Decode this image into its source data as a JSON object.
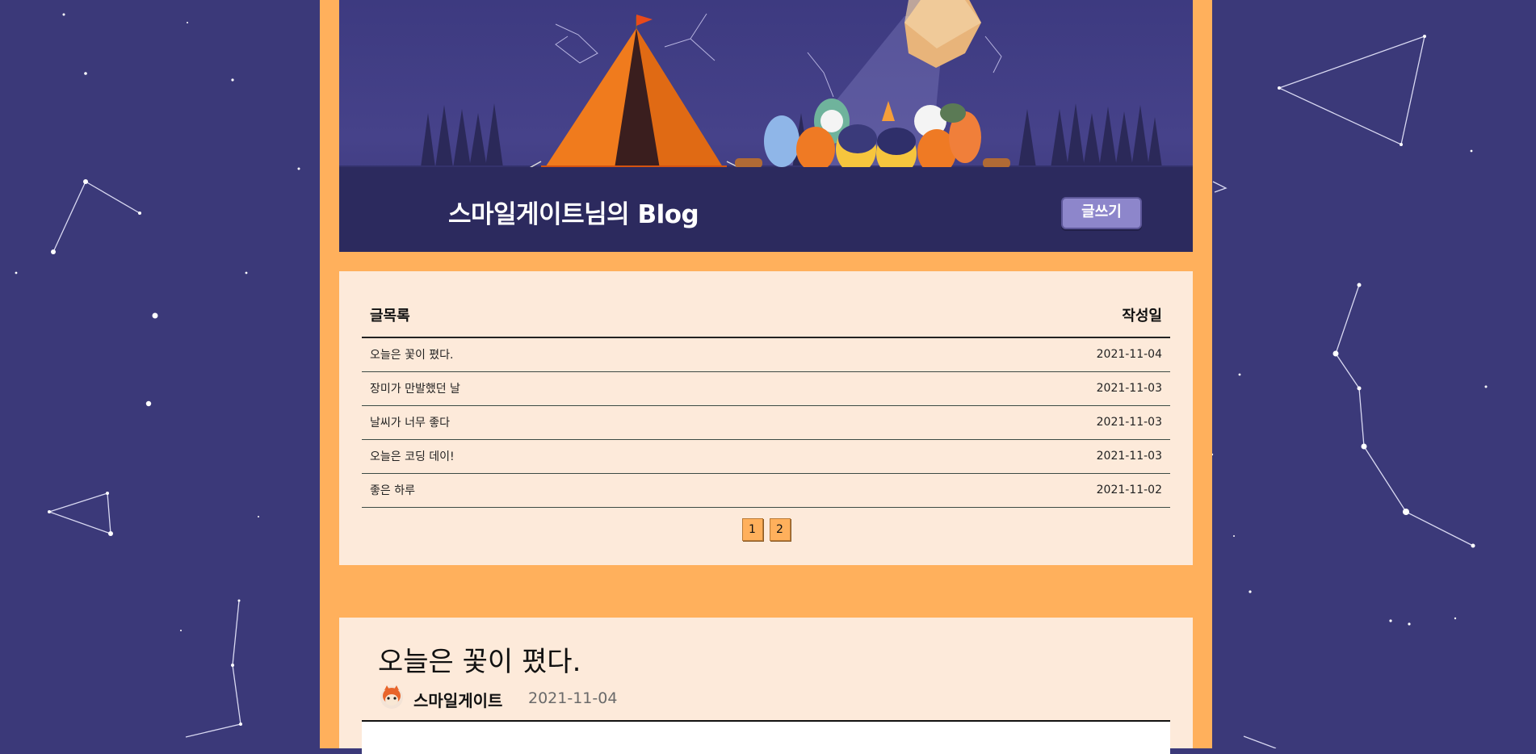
{
  "colors": {
    "sky": "#3b3979",
    "wrapper": "#ffb05c",
    "panel": "#fdeada",
    "banner_bar": "#2c2a5e",
    "write_button": "#8d86cb"
  },
  "header": {
    "blog_title": "스마일게이트님의 Blog",
    "write_button_label": "글쓰기"
  },
  "post_list": {
    "title_column": "글목록",
    "date_column": "작성일",
    "rows": [
      {
        "title": "오늘은 꽃이 폈다.",
        "date": "2021-11-04"
      },
      {
        "title": "장미가 만발했던 날",
        "date": "2021-11-03"
      },
      {
        "title": "날씨가 너무 좋다",
        "date": "2021-11-03"
      },
      {
        "title": "오늘은 코딩 데이!",
        "date": "2021-11-03"
      },
      {
        "title": "좋은 하루",
        "date": "2021-11-02"
      }
    ],
    "pages": [
      "1",
      "2"
    ]
  },
  "post": {
    "title": "오늘은 꽃이 폈다.",
    "author": "스마일게이트",
    "date": "2021-11-04"
  }
}
